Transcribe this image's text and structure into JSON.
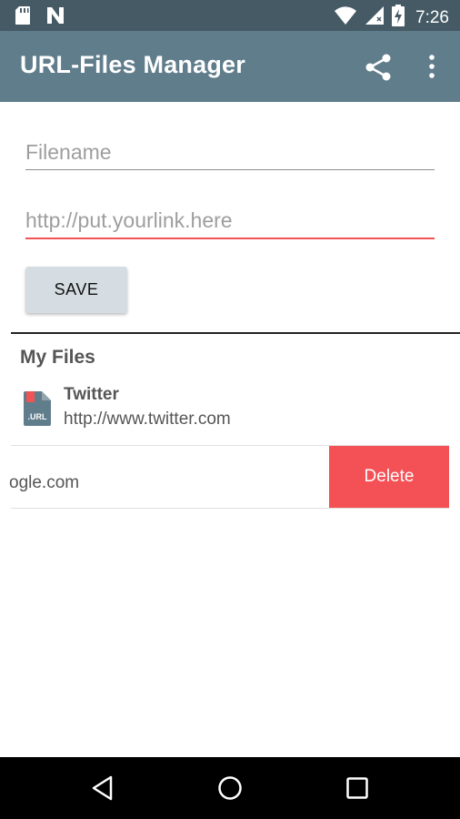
{
  "status_bar": {
    "time": "7:26",
    "icons": [
      "sd-card-icon",
      "n-logo-icon",
      "wifi-icon",
      "signal-icon",
      "battery-charging-icon"
    ]
  },
  "app_bar": {
    "title": "URL-Files Manager",
    "actions": [
      "share-icon",
      "more-vert-icon"
    ]
  },
  "form": {
    "filename_placeholder": "Filename",
    "filename_value": "",
    "url_placeholder": "http://put.yourlink.here",
    "url_value": "",
    "save_label": "SAVE"
  },
  "files": {
    "section_title": "My Files",
    "items": [
      {
        "title": "Twitter",
        "url": "http://www.twitter.com",
        "icon": "url-file-icon",
        "icon_text": ".URL"
      },
      {
        "title": "",
        "url": "ogle.com",
        "action_label": "Delete"
      }
    ]
  },
  "colors": {
    "status_bar": "#455a64",
    "app_bar": "#607d8b",
    "accent": "#f05454",
    "delete": "#f45157",
    "button": "#d5dde2"
  },
  "nav_bar": {
    "buttons": [
      "back-icon",
      "home-icon",
      "recents-icon"
    ]
  }
}
